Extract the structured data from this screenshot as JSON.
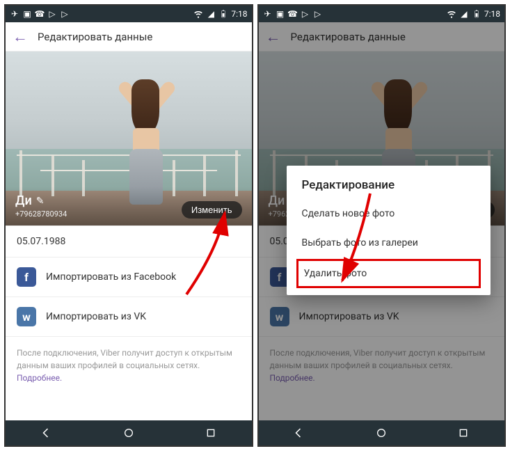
{
  "status": {
    "time": "7:18"
  },
  "appbar": {
    "title": "Редактировать данные"
  },
  "profile": {
    "name": "Ди",
    "phone": "+79628780934",
    "change_label": "Изменить",
    "dob": "05.07.1988"
  },
  "import": {
    "facebook_label": "Импортировать из Facebook",
    "vk_label": "Импортировать из VK"
  },
  "footer": {
    "text": "После подключения, Viber получит доступ к открытым данным ваших профилей в социальных сетях.",
    "more_label": "Подробнее."
  },
  "dialog": {
    "title": "Редактирование",
    "items": {
      "new_photo": "Сделать новое фото",
      "from_gallery": "Выбрать фото из галереи",
      "delete_photo": "Удалить фото"
    }
  }
}
